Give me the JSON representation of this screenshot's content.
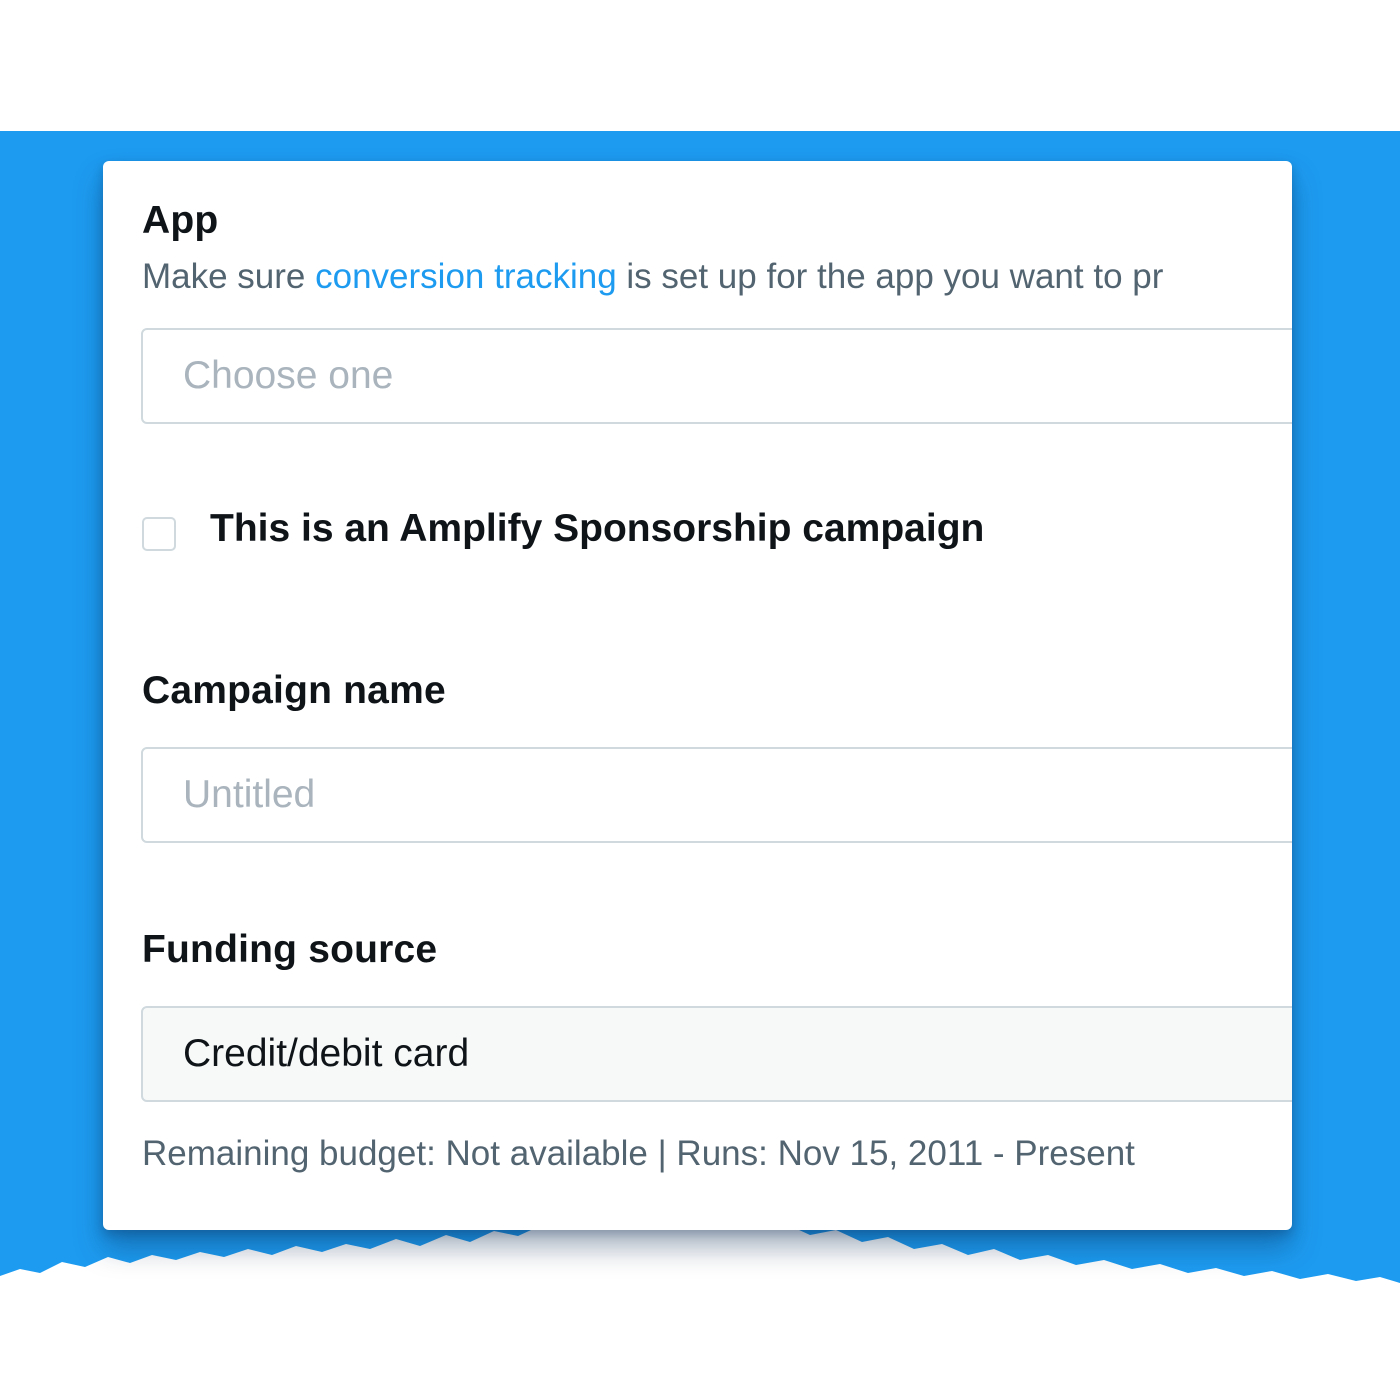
{
  "app_section": {
    "label": "App",
    "help_prefix": "Make sure ",
    "help_link": "conversion tracking",
    "help_suffix": " is set up for the app you want to pr",
    "select_placeholder": "Choose one"
  },
  "amplify_checkbox": {
    "label": "This is an Amplify Sponsorship campaign",
    "checked": false
  },
  "campaign_name": {
    "label": "Campaign name",
    "placeholder": "Untitled"
  },
  "funding_source": {
    "label": "Funding source",
    "value": "Credit/debit card",
    "note": "Remaining budget: Not available | Runs: Nov 15, 2011 - Present"
  },
  "colors": {
    "background_blue": "#1d9bf0",
    "link_blue": "#1d9bf0",
    "text_dark": "#0f1419",
    "text_muted": "#536471",
    "placeholder": "#a9b4bd",
    "border": "#cfd9de"
  }
}
